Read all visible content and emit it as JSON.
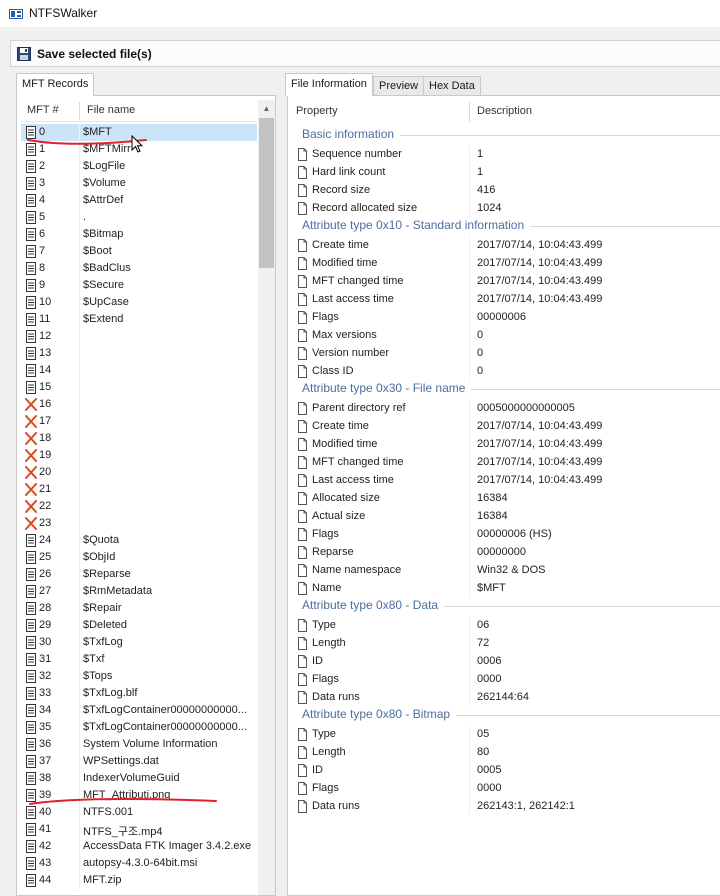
{
  "window": {
    "title": "NTFSWalker"
  },
  "toolbar": {
    "save_label": "Save selected file(s)"
  },
  "left_panel": {
    "tab": "MFT Records",
    "columns": {
      "num": "MFT #",
      "name": "File name"
    },
    "rows": [
      {
        "num": "0",
        "name": "$MFT",
        "deleted": false,
        "selected": true
      },
      {
        "num": "1",
        "name": "$MFTMirr",
        "deleted": false
      },
      {
        "num": "2",
        "name": "$LogFile",
        "deleted": false
      },
      {
        "num": "3",
        "name": "$Volume",
        "deleted": false
      },
      {
        "num": "4",
        "name": "$AttrDef",
        "deleted": false
      },
      {
        "num": "5",
        "name": ".",
        "deleted": false
      },
      {
        "num": "6",
        "name": "$Bitmap",
        "deleted": false
      },
      {
        "num": "7",
        "name": "$Boot",
        "deleted": false
      },
      {
        "num": "8",
        "name": "$BadClus",
        "deleted": false
      },
      {
        "num": "9",
        "name": "$Secure",
        "deleted": false
      },
      {
        "num": "10",
        "name": "$UpCase",
        "deleted": false
      },
      {
        "num": "11",
        "name": "$Extend",
        "deleted": false
      },
      {
        "num": "12",
        "name": "",
        "deleted": false
      },
      {
        "num": "13",
        "name": "",
        "deleted": false
      },
      {
        "num": "14",
        "name": "",
        "deleted": false
      },
      {
        "num": "15",
        "name": "",
        "deleted": false
      },
      {
        "num": "16",
        "name": "",
        "deleted": true
      },
      {
        "num": "17",
        "name": "",
        "deleted": true
      },
      {
        "num": "18",
        "name": "",
        "deleted": true
      },
      {
        "num": "19",
        "name": "",
        "deleted": true
      },
      {
        "num": "20",
        "name": "",
        "deleted": true
      },
      {
        "num": "21",
        "name": "",
        "deleted": true
      },
      {
        "num": "22",
        "name": "",
        "deleted": true
      },
      {
        "num": "23",
        "name": "",
        "deleted": true
      },
      {
        "num": "24",
        "name": "$Quota",
        "deleted": false
      },
      {
        "num": "25",
        "name": "$ObjId",
        "deleted": false
      },
      {
        "num": "26",
        "name": "$Reparse",
        "deleted": false
      },
      {
        "num": "27",
        "name": "$RmMetadata",
        "deleted": false
      },
      {
        "num": "28",
        "name": "$Repair",
        "deleted": false
      },
      {
        "num": "29",
        "name": "$Deleted",
        "deleted": false
      },
      {
        "num": "30",
        "name": "$TxfLog",
        "deleted": false
      },
      {
        "num": "31",
        "name": "$Txf",
        "deleted": false
      },
      {
        "num": "32",
        "name": "$Tops",
        "deleted": false
      },
      {
        "num": "33",
        "name": "$TxfLog.blf",
        "deleted": false
      },
      {
        "num": "34",
        "name": "$TxfLogContainer00000000000...",
        "deleted": false
      },
      {
        "num": "35",
        "name": "$TxfLogContainer00000000000...",
        "deleted": false
      },
      {
        "num": "36",
        "name": "System Volume Information",
        "deleted": false
      },
      {
        "num": "37",
        "name": "WPSettings.dat",
        "deleted": false
      },
      {
        "num": "38",
        "name": "IndexerVolumeGuid",
        "deleted": false
      },
      {
        "num": "39",
        "name": "MFT_Attributi.png",
        "deleted": false
      },
      {
        "num": "40",
        "name": "NTFS.001",
        "deleted": false
      },
      {
        "num": "41",
        "name": "NTFS_구조.mp4",
        "deleted": false
      },
      {
        "num": "42",
        "name": "AccessData FTK Imager 3.4.2.exe",
        "deleted": false
      },
      {
        "num": "43",
        "name": "autopsy-4.3.0-64bit.msi",
        "deleted": false
      },
      {
        "num": "44",
        "name": "MFT.zip",
        "deleted": false
      }
    ]
  },
  "right_panel": {
    "tabs": [
      "File Information",
      "Preview",
      "Hex Data"
    ],
    "columns": {
      "property": "Property",
      "description": "Description"
    },
    "groups": [
      {
        "title": "Basic information",
        "props": [
          {
            "name": "Sequence number",
            "value": "1"
          },
          {
            "name": "Hard link count",
            "value": "1"
          },
          {
            "name": "Record size",
            "value": "416"
          },
          {
            "name": "Record allocated size",
            "value": "1024"
          }
        ]
      },
      {
        "title": "Attribute type 0x10 - Standard information",
        "props": [
          {
            "name": "Create time",
            "value": "2017/07/14, 10:04:43.499"
          },
          {
            "name": "Modified time",
            "value": "2017/07/14, 10:04:43.499"
          },
          {
            "name": "MFT changed time",
            "value": "2017/07/14, 10:04:43.499"
          },
          {
            "name": "Last access time",
            "value": "2017/07/14, 10:04:43.499"
          },
          {
            "name": "Flags",
            "value": "00000006"
          },
          {
            "name": "Max versions",
            "value": "0"
          },
          {
            "name": "Version number",
            "value": "0"
          },
          {
            "name": "Class ID",
            "value": "0"
          }
        ]
      },
      {
        "title": "Attribute type 0x30 - File name",
        "props": [
          {
            "name": "Parent directory ref",
            "value": "0005000000000005"
          },
          {
            "name": "Create time",
            "value": "2017/07/14, 10:04:43.499"
          },
          {
            "name": "Modified time",
            "value": "2017/07/14, 10:04:43.499"
          },
          {
            "name": "MFT changed time",
            "value": "2017/07/14, 10:04:43.499"
          },
          {
            "name": "Last access time",
            "value": "2017/07/14, 10:04:43.499"
          },
          {
            "name": "Allocated size",
            "value": "16384"
          },
          {
            "name": "Actual size",
            "value": "16384"
          },
          {
            "name": "Flags",
            "value": "00000006 (HS)"
          },
          {
            "name": "Reparse",
            "value": "00000000"
          },
          {
            "name": "Name namespace",
            "value": "Win32 & DOS"
          },
          {
            "name": "Name",
            "value": "$MFT"
          }
        ]
      },
      {
        "title": "Attribute type 0x80 - Data",
        "props": [
          {
            "name": "Type",
            "value": "06"
          },
          {
            "name": "Length",
            "value": "72"
          },
          {
            "name": "ID",
            "value": "0006"
          },
          {
            "name": "Flags",
            "value": "0000"
          },
          {
            "name": "Data runs",
            "value": "262144:64"
          }
        ]
      },
      {
        "title": "Attribute type 0x80 - Bitmap",
        "props": [
          {
            "name": "Type",
            "value": "05"
          },
          {
            "name": "Length",
            "value": "80"
          },
          {
            "name": "ID",
            "value": "0005"
          },
          {
            "name": "Flags",
            "value": "0000"
          },
          {
            "name": "Data runs",
            "value": "262143:1, 262142:1"
          }
        ]
      }
    ]
  },
  "colors": {
    "selection": "#cce4f7",
    "group_title": "#4a6ea0",
    "annotation": "#e0202a",
    "deleted_x": "#d84a1a"
  },
  "icons": {
    "app": "ntfswalker-app-icon",
    "save": "floppy-disk-icon",
    "file": "file-icon",
    "deleted": "deleted-x-icon",
    "property": "property-doc-icon"
  }
}
